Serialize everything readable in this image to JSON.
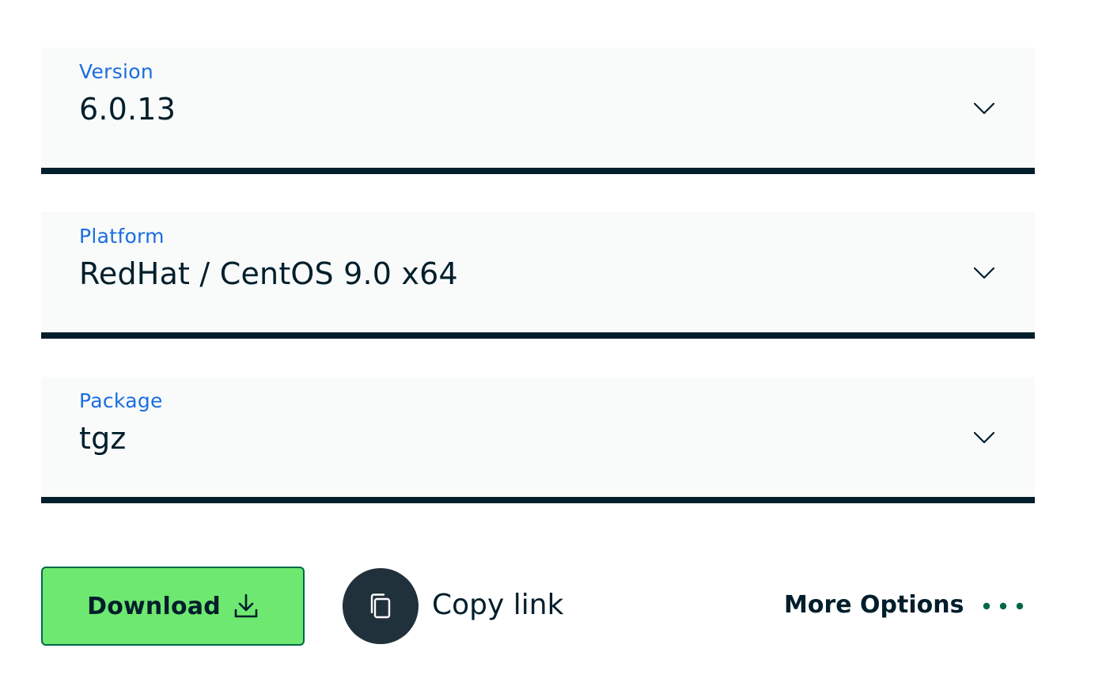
{
  "version": {
    "label": "Version",
    "value": "6.0.13",
    "icon": "chevron-down-icon"
  },
  "platform": {
    "label": "Platform",
    "value": "RedHat / CentOS 9.0 x64",
    "icon": "chevron-down-icon"
  },
  "package": {
    "label": "Package",
    "value": "tgz",
    "icon": "chevron-down-icon"
  },
  "actions": {
    "download_label": "Download",
    "download_icon": "download-icon",
    "copy_label": "Copy link",
    "copy_icon": "copy-icon",
    "more_label": "More Options",
    "more_icon": "ellipsis-icon"
  },
  "colors": {
    "label_blue": "#1a6de0",
    "text_dark": "#001e2b",
    "field_bg": "#f9fbfa",
    "download_green": "#6ee870",
    "download_border": "#00684a",
    "copy_circle": "#21313c",
    "dots_green": "#00684a"
  }
}
